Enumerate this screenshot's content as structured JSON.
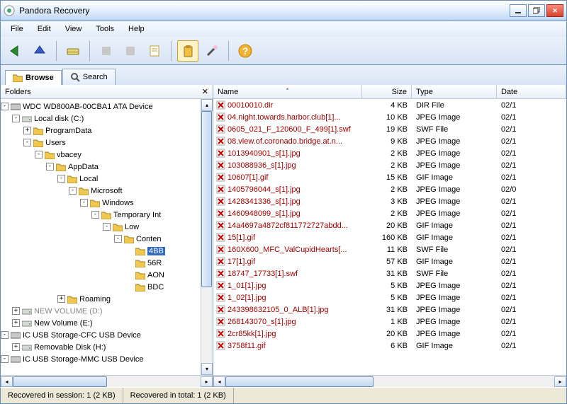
{
  "title": "Pandora Recovery",
  "menu": [
    "File",
    "Edit",
    "View",
    "Tools",
    "Help"
  ],
  "tabs": {
    "browse": "Browse",
    "search": "Search"
  },
  "tree_header": {
    "label": "Folders"
  },
  "columns": {
    "name": "Name",
    "size": "Size",
    "type": "Type",
    "date": "Date"
  },
  "status": {
    "session": "Recovered in session: 1 (2 KB)",
    "total": "Recovered in total: 1 (2 KB)"
  },
  "tree": {
    "dev0": "WDC WD800AB-00CBA1 ATA Device",
    "c": "Local disk (C:)",
    "programdata": "ProgramData",
    "users": "Users",
    "vbacey": "vbacey",
    "appdata": "AppData",
    "local": "Local",
    "microsoft": "Microsoft",
    "windows": "Windows",
    "tempint": "Temporary Int",
    "low": "Low",
    "conten": "Conten",
    "sel": "4BB",
    "s56r": "56R",
    "saon": "AON",
    "sbdc": "BDC",
    "roaming": "Roaming",
    "d": "NEW VOLUME (D:)",
    "e": "New Volume (E:)",
    "usb_cfc": "IC USB Storage-CFC USB Device",
    "h": "Removable Disk (H:)",
    "usb_mmc": "IC USB Storage-MMC USB Device"
  },
  "files": [
    {
      "name": "00010010.dir",
      "size": "4 KB",
      "type": "DIR File",
      "date": "02/1"
    },
    {
      "name": "04.night.towards.harbor.club[1]...",
      "size": "10 KB",
      "type": "JPEG Image",
      "date": "02/1"
    },
    {
      "name": "0605_021_F_120600_F_499[1].swf",
      "size": "19 KB",
      "type": "SWF File",
      "date": "02/1"
    },
    {
      "name": "08.view.of.coronado.bridge.at.n...",
      "size": "9 KB",
      "type": "JPEG Image",
      "date": "02/1"
    },
    {
      "name": "1013940901_s[1].jpg",
      "size": "2 KB",
      "type": "JPEG Image",
      "date": "02/1"
    },
    {
      "name": "103088936_s[1].jpg",
      "size": "2 KB",
      "type": "JPEG Image",
      "date": "02/1"
    },
    {
      "name": "10607[1].gif",
      "size": "15 KB",
      "type": "GIF Image",
      "date": "02/1"
    },
    {
      "name": "1405796044_s[1].jpg",
      "size": "2 KB",
      "type": "JPEG Image",
      "date": "02/0"
    },
    {
      "name": "1428341336_s[1].jpg",
      "size": "3 KB",
      "type": "JPEG Image",
      "date": "02/1"
    },
    {
      "name": "1460948099_s[1].jpg",
      "size": "2 KB",
      "type": "JPEG Image",
      "date": "02/1"
    },
    {
      "name": "14a4697a4872cf811772727abdd...",
      "size": "20 KB",
      "type": "GIF Image",
      "date": "02/1"
    },
    {
      "name": "15[1].gif",
      "size": "160 KB",
      "type": "GIF Image",
      "date": "02/1"
    },
    {
      "name": "160X600_MFC_ValCupidHearts[...",
      "size": "11 KB",
      "type": "SWF File",
      "date": "02/1"
    },
    {
      "name": "17[1].gif",
      "size": "57 KB",
      "type": "GIF Image",
      "date": "02/1"
    },
    {
      "name": "18747_17733[1].swf",
      "size": "31 KB",
      "type": "SWF File",
      "date": "02/1"
    },
    {
      "name": "1_01[1].jpg",
      "size": "5 KB",
      "type": "JPEG Image",
      "date": "02/1"
    },
    {
      "name": "1_02[1].jpg",
      "size": "5 KB",
      "type": "JPEG Image",
      "date": "02/1"
    },
    {
      "name": "243398632105_0_ALB[1].jpg",
      "size": "31 KB",
      "type": "JPEG Image",
      "date": "02/1"
    },
    {
      "name": "268143070_s[1].jpg",
      "size": "1 KB",
      "type": "JPEG Image",
      "date": "02/1"
    },
    {
      "name": "2cr85kk[1].jpg",
      "size": "20 KB",
      "type": "JPEG Image",
      "date": "02/1"
    },
    {
      "name": "3758f11.gif",
      "size": "6 KB",
      "type": "GIF Image",
      "date": "02/1"
    }
  ]
}
